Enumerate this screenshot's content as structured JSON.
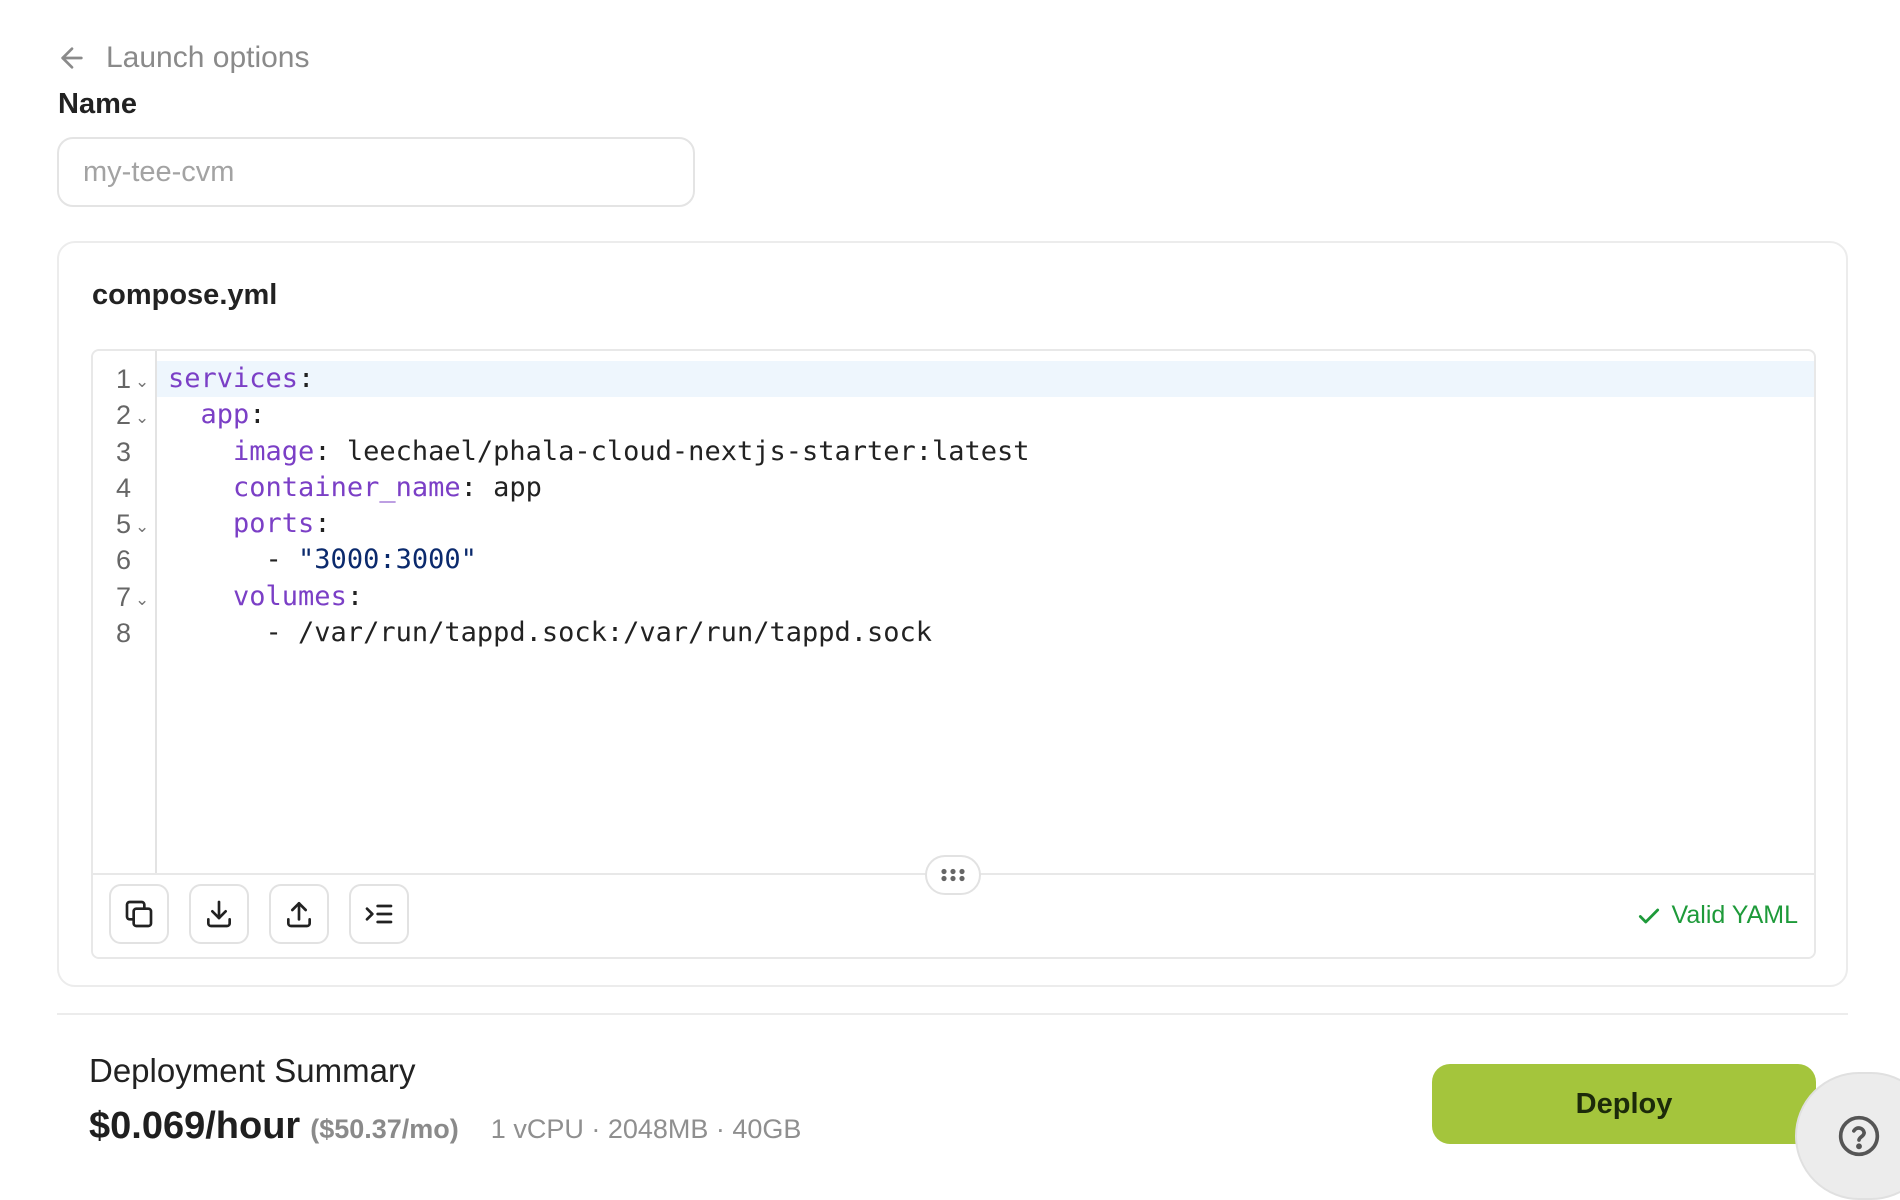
{
  "back": {
    "label": "Launch options"
  },
  "name_field": {
    "label": "Name",
    "placeholder": "my-tee-cvm",
    "value": ""
  },
  "compose": {
    "title": "compose.yml",
    "lines": [
      {
        "n": "1",
        "fold": true,
        "parts": [
          {
            "t": "services",
            "c": "k"
          },
          {
            "t": ":",
            "c": "p"
          }
        ]
      },
      {
        "n": "2",
        "fold": true,
        "parts": [
          {
            "t": "  ",
            "c": "p"
          },
          {
            "t": "app",
            "c": "k"
          },
          {
            "t": ":",
            "c": "p"
          }
        ]
      },
      {
        "n": "3",
        "fold": false,
        "parts": [
          {
            "t": "    ",
            "c": "p"
          },
          {
            "t": "image",
            "c": "k"
          },
          {
            "t": ": leechael/phala-cloud-nextjs-starter:latest",
            "c": "p"
          }
        ]
      },
      {
        "n": "4",
        "fold": false,
        "parts": [
          {
            "t": "    ",
            "c": "p"
          },
          {
            "t": "container_name",
            "c": "k"
          },
          {
            "t": ": app",
            "c": "p"
          }
        ]
      },
      {
        "n": "5",
        "fold": true,
        "parts": [
          {
            "t": "    ",
            "c": "p"
          },
          {
            "t": "ports",
            "c": "k"
          },
          {
            "t": ":",
            "c": "p"
          }
        ]
      },
      {
        "n": "6",
        "fold": false,
        "parts": [
          {
            "t": "      - ",
            "c": "p"
          },
          {
            "t": "\"3000:3000\"",
            "c": "s"
          }
        ]
      },
      {
        "n": "7",
        "fold": true,
        "parts": [
          {
            "t": "    ",
            "c": "p"
          },
          {
            "t": "volumes",
            "c": "k"
          },
          {
            "t": ":",
            "c": "p"
          }
        ]
      },
      {
        "n": "8",
        "fold": false,
        "parts": [
          {
            "t": "      - /var/run/tappd.sock:/var/run/tappd.sock",
            "c": "p"
          }
        ]
      }
    ],
    "toolbar": [
      "copy-icon",
      "download-icon",
      "upload-icon",
      "format-icon"
    ],
    "status": "Valid YAML"
  },
  "summary": {
    "title": "Deployment Summary",
    "price_hour": "$0.069/hour",
    "price_month": "($50.37/mo)",
    "specs": "1 vCPU · 2048MB · 40GB"
  },
  "deploy": {
    "label": "Deploy"
  },
  "colors": {
    "accent": "#a4c53c",
    "valid": "#1e9a3a",
    "yaml_key": "#7b3fc6",
    "yaml_string": "#0b2a6d",
    "active_line": "#eef6fd"
  }
}
